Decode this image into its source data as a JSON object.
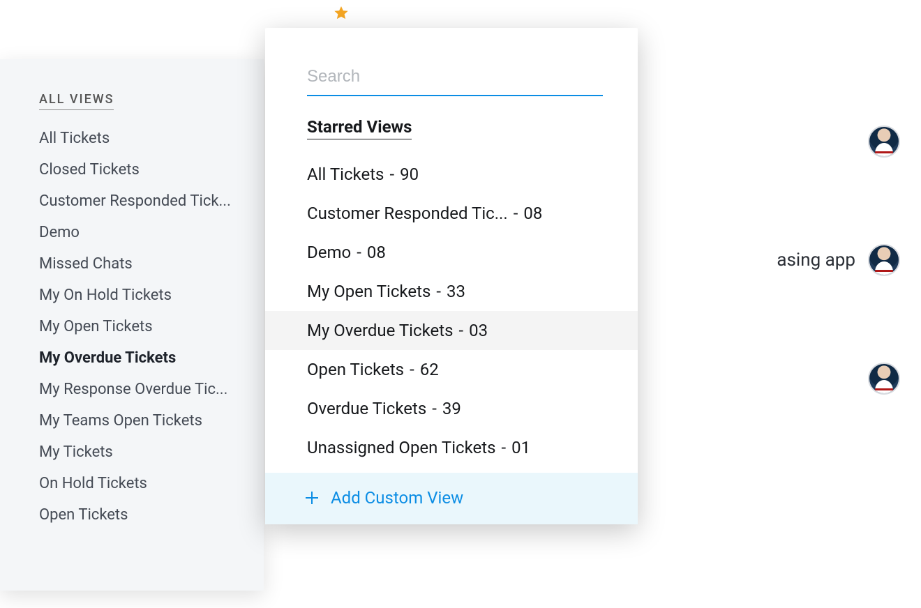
{
  "star_icon": "star-icon",
  "sidebar": {
    "title": "ALL VIEWS",
    "items": [
      {
        "label": "All Tickets",
        "active": false
      },
      {
        "label": "Closed Tickets",
        "active": false
      },
      {
        "label": "Customer Responded Tick...",
        "active": false
      },
      {
        "label": "Demo",
        "active": false
      },
      {
        "label": "Missed Chats",
        "active": false
      },
      {
        "label": "My On Hold Tickets",
        "active": false
      },
      {
        "label": "My Open Tickets",
        "active": false
      },
      {
        "label": "My Overdue Tickets",
        "active": true
      },
      {
        "label": "My Response Overdue Tic...",
        "active": false
      },
      {
        "label": "My Teams Open Tickets",
        "active": false
      },
      {
        "label": "My Tickets",
        "active": false
      },
      {
        "label": "On Hold Tickets",
        "active": false
      },
      {
        "label": "Open Tickets",
        "active": false
      }
    ]
  },
  "dropdown": {
    "search_placeholder": "Search",
    "section_title": "Starred Views",
    "items": [
      {
        "label": "All Tickets",
        "count": "90",
        "highlight": false
      },
      {
        "label": "Customer Responded Tic...",
        "count": "08",
        "highlight": false
      },
      {
        "label": "Demo",
        "count": "08",
        "highlight": false
      },
      {
        "label": "My Open Tickets",
        "count": "33",
        "highlight": false
      },
      {
        "label": "My Overdue Tickets",
        "count": "03",
        "highlight": true
      },
      {
        "label": "Open Tickets",
        "count": "62",
        "highlight": false
      },
      {
        "label": "Overdue Tickets",
        "count": "39",
        "highlight": false
      },
      {
        "label": "Unassigned Open Tickets",
        "count": "01",
        "highlight": false
      }
    ],
    "add_label": "Add Custom View"
  },
  "background": {
    "rows": [
      {
        "text": ""
      },
      {
        "text": "asing app"
      },
      {
        "text": ""
      }
    ]
  },
  "colors": {
    "accent": "#0b8de4",
    "star": "#f5a623",
    "panel": "#f4f6f8",
    "hover": "#f4f4f4",
    "add_bg": "#eaf7fc"
  }
}
